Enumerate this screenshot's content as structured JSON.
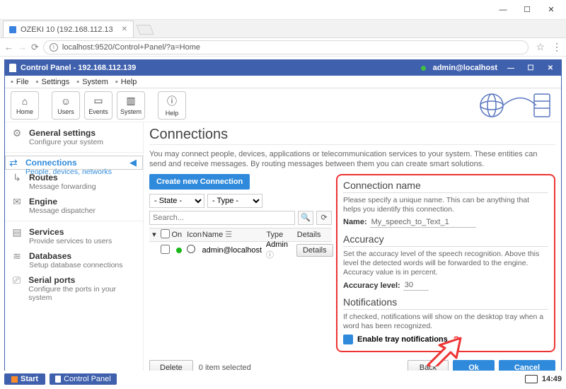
{
  "browser": {
    "tab_title": "OZEKI 10 (192.168.112.13",
    "url": "localhost:9520/Control+Panel/?a=Home"
  },
  "cp_window": {
    "title": "Control Panel - 192.168.112.139",
    "user": "admin@localhost",
    "menu": [
      "File",
      "Settings",
      "System",
      "Help"
    ],
    "toolbar": [
      {
        "id": "home",
        "label": "Home",
        "icon": "⌂"
      },
      {
        "id": "users",
        "label": "Users",
        "icon": "☺"
      },
      {
        "id": "events",
        "label": "Events",
        "icon": "▭"
      },
      {
        "id": "system",
        "label": "System",
        "icon": "▥"
      },
      {
        "id": "help",
        "label": "Help",
        "icon": "ⓘ"
      }
    ]
  },
  "sidebar": {
    "items": [
      {
        "icon": "⚙",
        "title": "General settings",
        "sub": "Configure your system"
      },
      {
        "icon": "⇄",
        "title": "Connections",
        "sub": "People, devices, networks",
        "selected": true
      },
      {
        "icon": "↳",
        "title": "Routes",
        "sub": "Message forwarding"
      },
      {
        "icon": "✉",
        "title": "Engine",
        "sub": "Message dispatcher"
      },
      {
        "icon": "▤",
        "title": "Services",
        "sub": "Provide services to users"
      },
      {
        "icon": "≋",
        "title": "Databases",
        "sub": "Setup database connections"
      },
      {
        "icon": "⎚",
        "title": "Serial ports",
        "sub": "Configure the ports in your system"
      }
    ]
  },
  "page": {
    "title": "Connections",
    "desc": "You may connect people, devices, applications or telecommunication services to your system. These entities can send and receive messages. By routing messages between them you can create smart solutions.",
    "create_btn": "Create new Connection",
    "state_label": "- State -",
    "type_label": "- Type -",
    "search_placeholder": "Search...",
    "columns": {
      "on": "On",
      "icon": "Icon",
      "name": "Name",
      "type": "Type",
      "details": "Details"
    },
    "rows": [
      {
        "on": true,
        "name": "admin@localhost",
        "type": "Admin",
        "details_btn": "Details"
      }
    ],
    "delete_btn": "Delete",
    "sel_info": "0 item selected",
    "back_btn": "Back",
    "ok_btn": "Ok",
    "cancel_btn": "Cancel"
  },
  "form": {
    "sections": {
      "name": {
        "head": "Connection name",
        "desc": "Please specify a unique name. This can be anything that helps you identify this connection.",
        "label": "Name:",
        "value": "My_speech_to_Text_1"
      },
      "accuracy": {
        "head": "Accuracy",
        "desc": "Set the accuracy level of the speech recognition. Above this level the detected words will be forwarded to the engine. Accuracy value is in percent.",
        "label": "Accuracy level:",
        "value": "30"
      },
      "notif": {
        "head": "Notifications",
        "desc": "If checked, notifications will show on the desktop tray when a word has been recognized.",
        "label": "Enable tray notifications"
      }
    }
  },
  "taskbar": {
    "start": "Start",
    "task": "Control Panel",
    "clock": "14:49"
  }
}
